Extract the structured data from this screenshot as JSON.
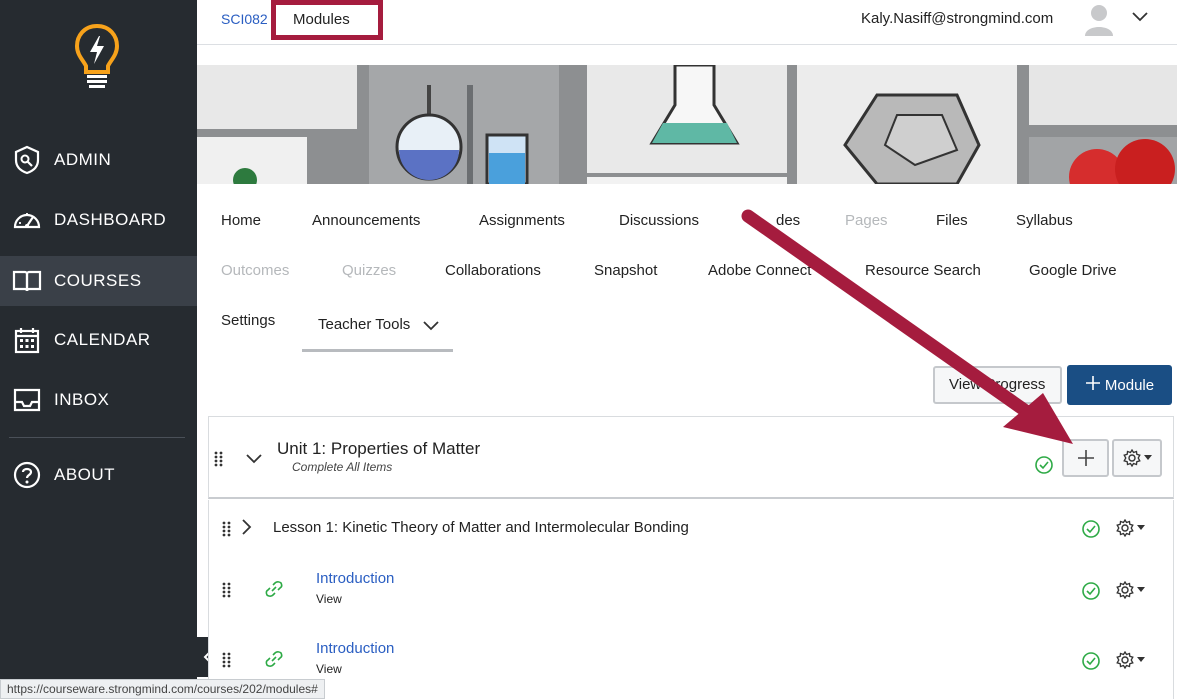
{
  "sidebar": {
    "items": [
      {
        "label": "ADMIN",
        "icon": "admin-shield-icon"
      },
      {
        "label": "DASHBOARD",
        "icon": "speedometer-icon"
      },
      {
        "label": "COURSES",
        "icon": "book-icon",
        "active": true
      },
      {
        "label": "CALENDAR",
        "icon": "calendar-icon"
      },
      {
        "label": "INBOX",
        "icon": "inbox-icon"
      },
      {
        "label": "ABOUT",
        "icon": "help-icon"
      }
    ],
    "logo_icon": "lightbulb-logo-icon",
    "logo_color": "#f7a21b"
  },
  "breadcrumb": {
    "course": "SCI082",
    "current": "Modules"
  },
  "user": {
    "email": "Kaly.Nasiff@strongmind.com"
  },
  "course_nav": {
    "row1": [
      "Home",
      "Announcements",
      "Assignments",
      "Discussions",
      "des",
      "Pages",
      "Files",
      "Syllabus"
    ],
    "row2": [
      "Outcomes",
      "Quizzes",
      "Collaborations",
      "Snapshot",
      "Adobe Connect",
      "Resource Search",
      "Google Drive"
    ],
    "row3": [
      "Settings",
      "Teacher Tools"
    ]
  },
  "actions": {
    "view_progress": "View Progress",
    "add_module": "Module"
  },
  "module": {
    "title": "Unit 1: Properties of Matter",
    "requirement": "Complete All Items",
    "items": [
      {
        "type": "subheader",
        "title": "Lesson 1: Kinetic Theory of Matter and Intermolecular Bonding"
      },
      {
        "type": "link",
        "title": "Introduction",
        "sub": "View"
      },
      {
        "type": "link",
        "title": "Introduction",
        "sub": "View"
      }
    ]
  },
  "status_bar": {
    "url": "https://courseware.strongmind.com/courses/202/modules#"
  },
  "colors": {
    "sidebar_bg": "#262b30",
    "primary_button": "#1a4e84",
    "link": "#2a5ec2",
    "highlight": "#a51c3e",
    "success": "#2eaa46"
  }
}
